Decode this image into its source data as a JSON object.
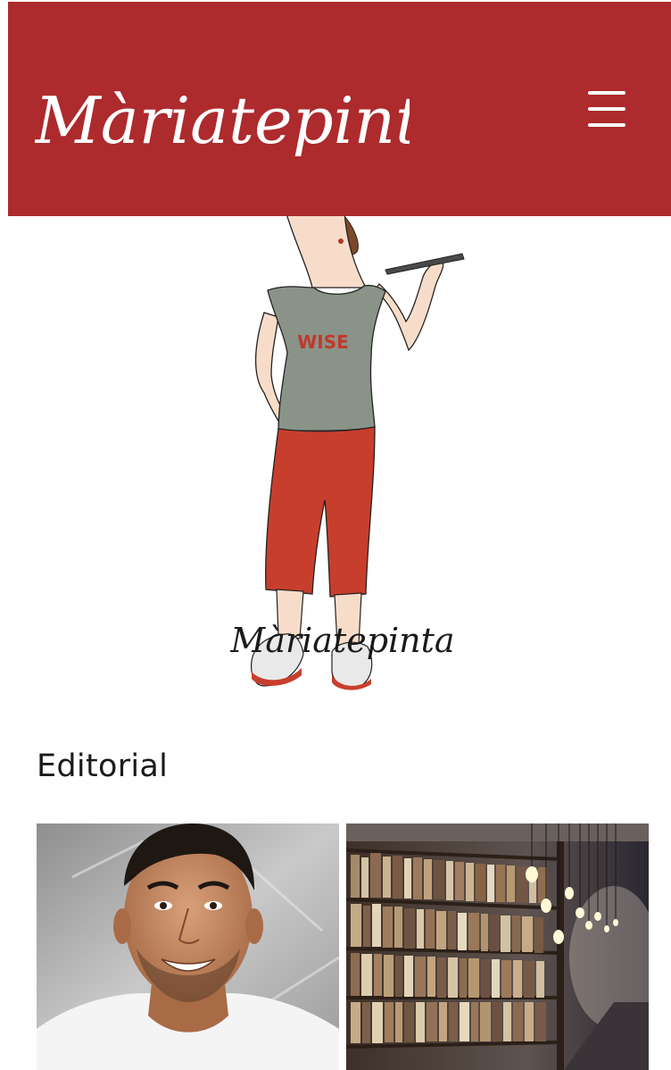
{
  "header": {
    "logo_text": "Màriatepinta",
    "background_color": "#ad2a2d",
    "menu_icon": "hamburger-menu-icon"
  },
  "hero": {
    "shirt_text": "WISE",
    "signature_text": "Màriatepinta"
  },
  "editorial": {
    "title": "Editorial",
    "cards": [
      {
        "image": "portrait-photo"
      },
      {
        "image": "library-bookshelves-photo"
      }
    ]
  }
}
